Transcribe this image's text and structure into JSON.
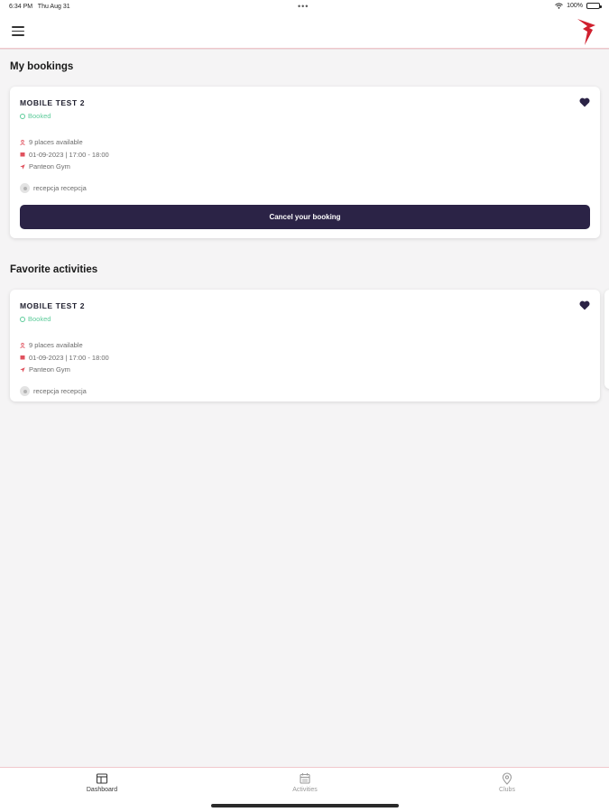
{
  "status_bar": {
    "time": "6:34 PM",
    "date": "Thu Aug 31",
    "dots": "•••",
    "battery": "100%"
  },
  "header": {
    "menu_icon": "hamburger-icon",
    "logo_icon": "brand-logo",
    "brand_color": "#d0202e"
  },
  "my_bookings": {
    "title": "My bookings",
    "card": {
      "activity": "MOBILE TEST 2",
      "status": "Booked",
      "places": "9 places available",
      "datetime": "01-09-2023 | 17:00 - 18:00",
      "location": "Panteon Gym",
      "instructor": "recepcja recepcja",
      "cancel_label": "Cancel your booking",
      "favorite_icon": "heart-icon"
    }
  },
  "favorite_activities": {
    "title": "Favorite activities",
    "card": {
      "activity": "MOBILE TEST 2",
      "status": "Booked",
      "places": "9 places available",
      "datetime": "01-09-2023 | 17:00 - 18:00",
      "location": "Panteon Gym",
      "instructor": "recepcja recepcja",
      "favorite_icon": "heart-icon"
    }
  },
  "bottom_nav": {
    "items": [
      {
        "label": "Dashboard",
        "icon": "dashboard-icon",
        "active": true
      },
      {
        "label": "Activities",
        "icon": "calendar-icon",
        "active": false
      },
      {
        "label": "Clubs",
        "icon": "location-pin-icon",
        "active": false
      }
    ]
  },
  "colors": {
    "accent_dark": "#2b2346",
    "booked_green": "#5ccb9a",
    "info_red": "#e0525e"
  }
}
